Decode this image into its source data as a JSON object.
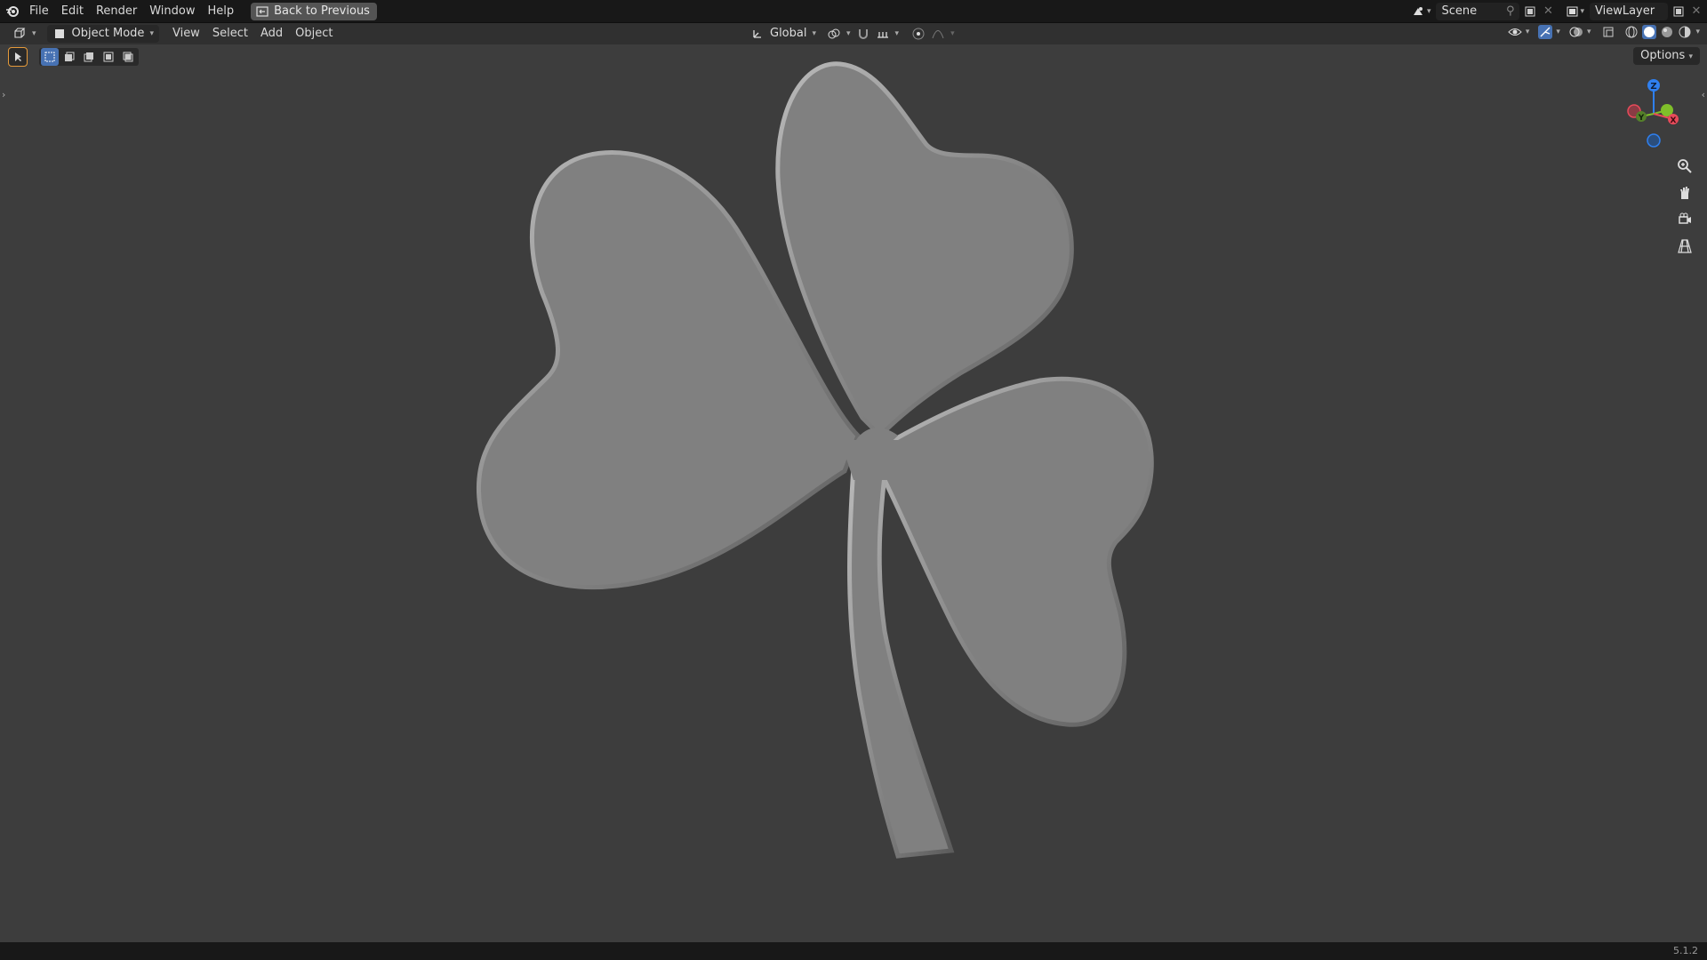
{
  "topbar": {
    "menus": [
      "File",
      "Edit",
      "Render",
      "Window",
      "Help"
    ],
    "back_label": "Back to Previous",
    "scene_name": "Scene",
    "view_layer": "ViewLayer"
  },
  "header": {
    "mode": "Object Mode",
    "menus": [
      "View",
      "Select",
      "Add",
      "Object"
    ],
    "orientation": "Global"
  },
  "viewport": {
    "options_label": "Options",
    "object": "shamrock mesh",
    "colors": {
      "background": "#3d3d3d",
      "mesh": "#808080",
      "accent": "#4772b3"
    },
    "gizmo_axes": [
      "Z",
      "Y",
      "X"
    ]
  },
  "status": {
    "version": "5.1.2"
  }
}
